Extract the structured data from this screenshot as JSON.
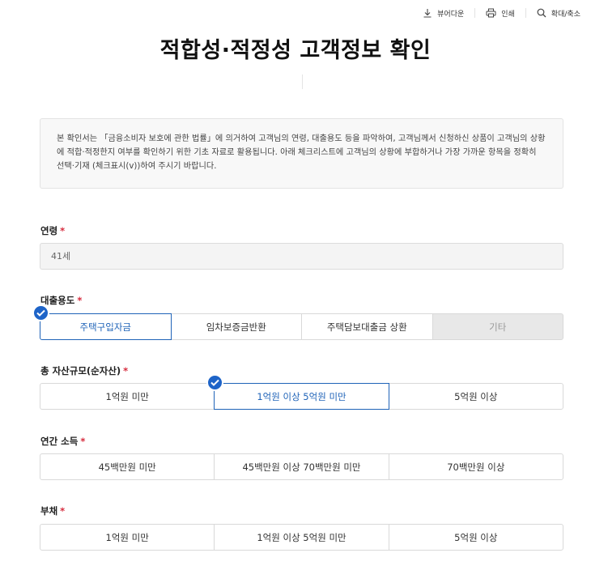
{
  "toolbar": {
    "viewer_label": "뷰어다운",
    "print_label": "인쇄",
    "zoom_label": "확대/축소"
  },
  "page": {
    "title": "적합성·적정성 고객정보 확인",
    "notice": "본 확인서는 「금융소비자 보호에 관한 법률」에 의거하여 고객님의 연령, 대출용도 등을 파악하여, 고객님께서 신청하신 상품이 고객님의 상황에 적합·적정한지 여부를 확인하기 위한 기초 자료로 활용됩니다. 아래 체크리스트에 고객님의 상황에 부합하거나 가장 가까운 항목을 정확히 선택·기재 (체크표시(v))하여 주시기 바랍니다."
  },
  "required_mark": "*",
  "age": {
    "label": "연령",
    "value": "41세"
  },
  "loan_purpose": {
    "label": "대출용도",
    "options": [
      "주택구입자금",
      "임차보증금반환",
      "주택담보대출금 상환",
      "기타"
    ],
    "selected": "주택구입자금"
  },
  "total_assets": {
    "label": "총 자산규모(순자산)",
    "options": [
      "1억원 미만",
      "1억원 이상 5억원 미만",
      "5억원 이상"
    ],
    "selected": "1억원 이상 5억원 미만"
  },
  "annual_income": {
    "label": "연간 소득",
    "options": [
      "45백만원 미만",
      "45백만원 이상 70백만원 미만",
      "70백만원 이상"
    ]
  },
  "debt": {
    "label": "부채",
    "options": [
      "1억원 미만",
      "1억원 이상 5억원 미만",
      "5억원 이상"
    ]
  },
  "colors": {
    "accent": "#1f63b8",
    "check_badge": "#1e64c8",
    "required": "#d62b3d"
  }
}
